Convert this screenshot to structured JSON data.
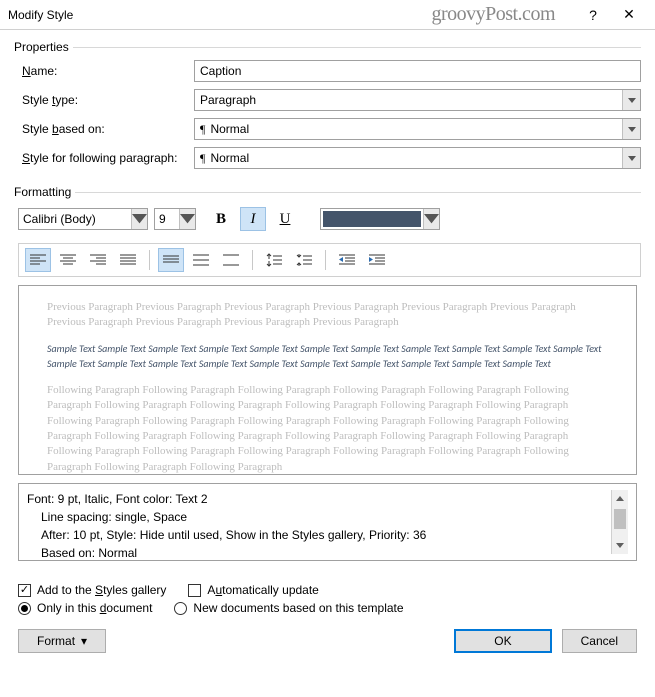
{
  "titlebar": {
    "title": "Modify Style",
    "watermark": "groovyPost.com",
    "help": "?",
    "close": "✕"
  },
  "properties": {
    "legend": "Properties",
    "name_label": "Name:",
    "name_value": "Caption",
    "type_label": "Style type:",
    "type_value": "Paragraph",
    "based_label": "Style based on:",
    "based_value": "Normal",
    "following_label": "Style for following paragraph:",
    "following_value": "Normal"
  },
  "formatting": {
    "legend": "Formatting",
    "font": "Calibri (Body)",
    "size": "9",
    "color": "#44546a"
  },
  "preview": {
    "prev": "Previous Paragraph Previous Paragraph Previous Paragraph Previous Paragraph Previous Paragraph Previous Paragraph Previous Paragraph Previous Paragraph Previous Paragraph Previous Paragraph",
    "sample": "Sample Text Sample Text Sample Text Sample Text Sample Text Sample Text Sample Text Sample Text Sample Text Sample Text Sample Text Sample Text Sample Text Sample Text Sample Text Sample Text Sample Text Sample Text Sample Text Sample Text Sample Text",
    "after": "Following Paragraph Following Paragraph Following Paragraph Following Paragraph Following Paragraph Following Paragraph Following Paragraph Following Paragraph Following Paragraph Following Paragraph Following Paragraph Following Paragraph Following Paragraph Following Paragraph Following Paragraph Following Paragraph Following Paragraph Following Paragraph Following Paragraph Following Paragraph Following Paragraph Following Paragraph Following Paragraph Following Paragraph Following Paragraph Following Paragraph Following Paragraph Following Paragraph Following Paragraph Following Paragraph"
  },
  "description": {
    "line1": "Font: 9 pt, Italic, Font color: Text 2",
    "line2": "Line spacing:  single, Space",
    "line3": "After:  10 pt, Style: Hide until used, Show in the Styles gallery, Priority: 36",
    "line4": "Based on: Normal"
  },
  "options": {
    "add_gallery": "Add to the Styles gallery",
    "auto_update": "Automatically update",
    "only_doc": "Only in this document",
    "new_tmpl": "New documents based on this template"
  },
  "buttons": {
    "format": "Format",
    "ok": "OK",
    "cancel": "Cancel"
  }
}
